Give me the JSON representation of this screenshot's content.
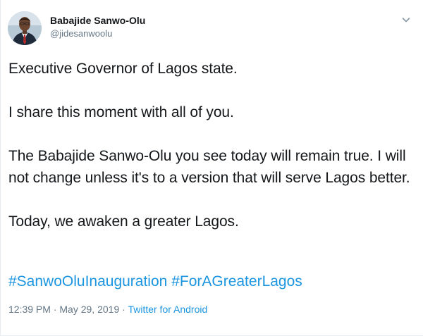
{
  "author": {
    "display_name": "Babajide Sanwo-Olu",
    "handle": "@jidesanwoolu"
  },
  "tweet": {
    "paragraphs": [
      "Executive Governor of Lagos state.",
      "I share this moment with all of you.",
      "The Babajide Sanwo-Olu you see today will remain true. I will not change unless it's to a version that will serve Lagos better.",
      "Today, we awaken a greater Lagos."
    ],
    "hashtags": [
      "#SanwoOluInauguration",
      "#ForAGreaterLagos"
    ]
  },
  "meta": {
    "time": "12:39 PM",
    "separator": " · ",
    "date": "May 29, 2019",
    "source": "Twitter for Android"
  },
  "icons": {
    "menu": "chevron-down-icon",
    "avatar": "profile-photo"
  },
  "colors": {
    "link": "#1b95e0",
    "secondary_text": "#657786",
    "primary_text": "#14171a"
  }
}
